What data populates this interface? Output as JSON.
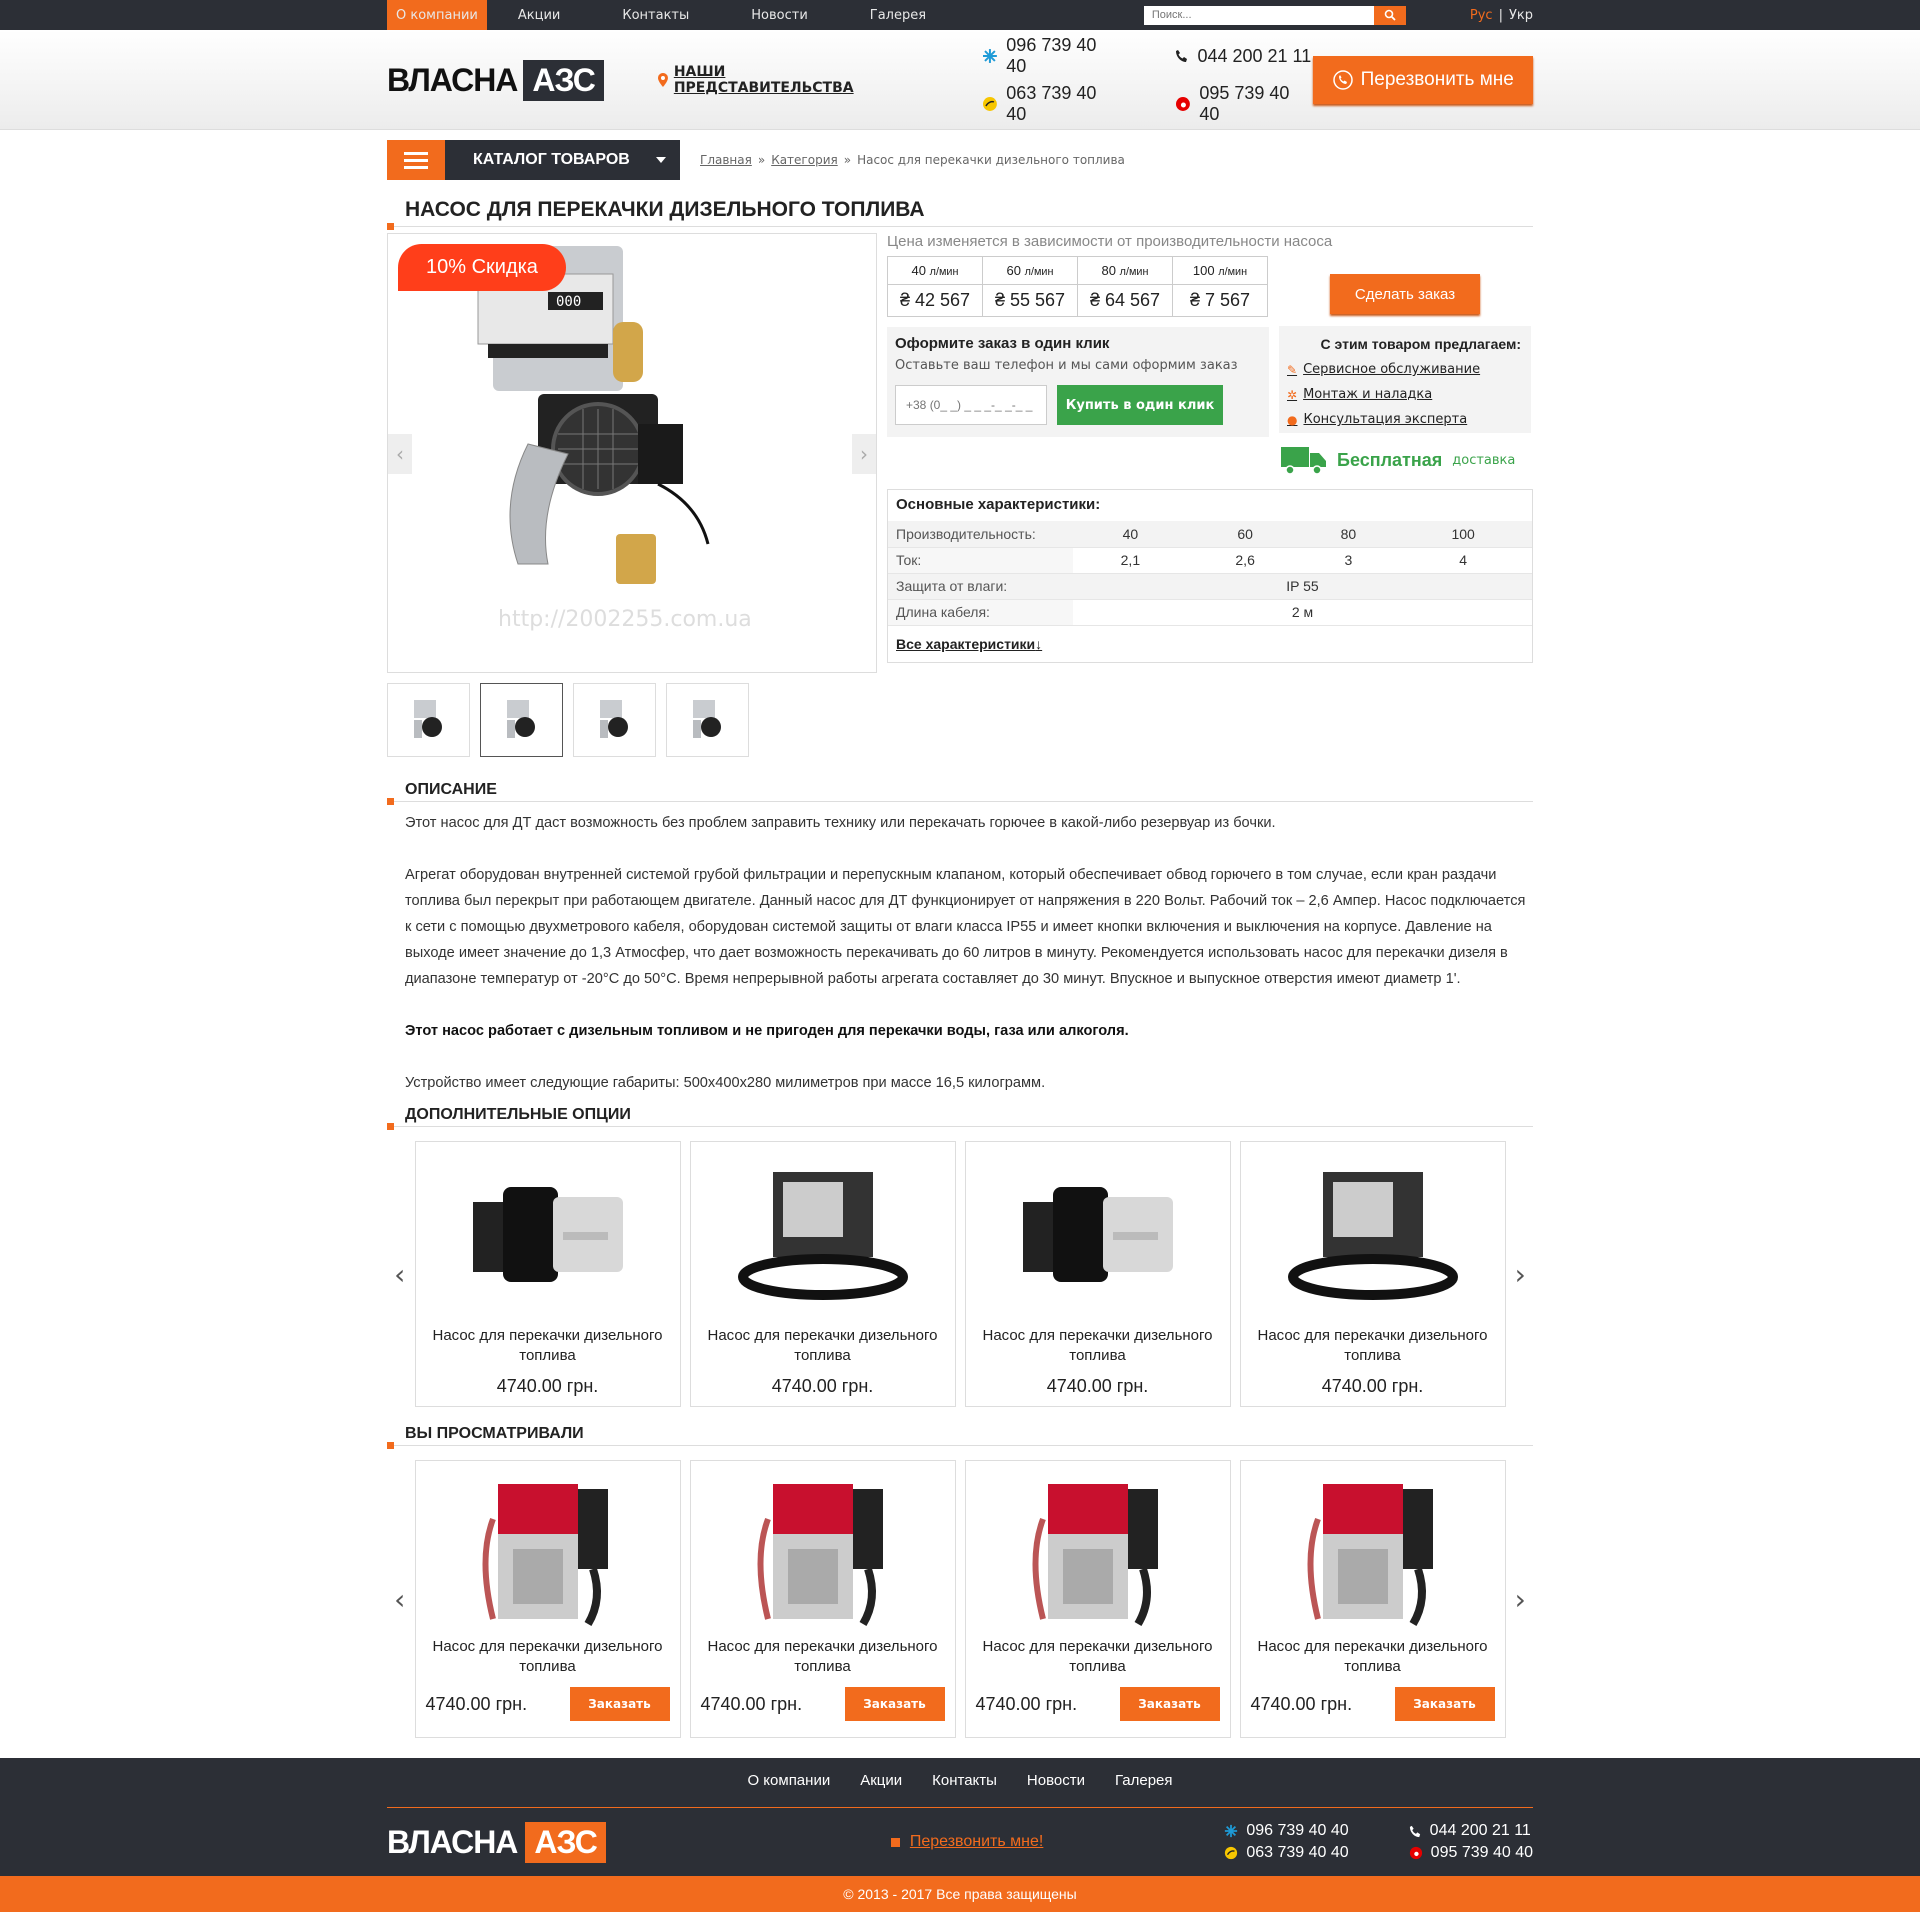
{
  "topbar": {
    "nav": [
      "О компании",
      "Акции",
      "Контакты",
      "Новости",
      "Галерея"
    ],
    "search_placeholder": "Поиск...",
    "lang_ru": "Рус",
    "lang_sep": "|",
    "lang_uk": "Укр"
  },
  "header": {
    "logo_part1": "ВЛАСНА",
    "logo_part2": "АЗС",
    "representatives": "НАШИ ПРЕДСТАВИТЕЛЬСТВА",
    "phone_kyivstar": "096 739 40 40",
    "phone_city": "044 200 21 11",
    "phone_life": "063 739 40 40",
    "phone_vodafone": "095 739 40 40",
    "callback": "Перезвонить мне"
  },
  "catalog": {
    "label": "КАТАЛОГ ТОВАРОВ"
  },
  "breadcrumb": {
    "home": "Главная",
    "category": "Категория",
    "current": "Насос для перекачки дизельного топлива",
    "sep": "»"
  },
  "product": {
    "title": "НАСОС ДЛЯ ПЕРЕКАЧКИ ДИЗЕЛЬНОГО ТОПЛИВА",
    "badge": "10% Скидка",
    "watermark": "http://2002255.com.ua",
    "price_note": "Цена изменяется в зависимости от производительности насоса",
    "price_options": [
      {
        "rate": "40",
        "unit": "л/мин",
        "price": "₴ 42 567"
      },
      {
        "rate": "60",
        "unit": "л/мин",
        "price": "₴ 55 567"
      },
      {
        "rate": "80",
        "unit": "л/мин",
        "price": "₴ 64 567"
      },
      {
        "rate": "100",
        "unit": "л/мин",
        "price": "₴ 7 567"
      }
    ],
    "order_button": "Сделать заказ",
    "one_click_title": "Оформите заказ в один клик",
    "one_click_sub": "Оставьте ваш телефон и мы сами оформим заказ",
    "phone_placeholder": "+38 (0_ _) _ _ _-_ _-_ _",
    "buy_one_click": "Купить в один клик",
    "offers_title": "С этим товаром предлагаем:",
    "offers": [
      "Сервисное обслуживание",
      "Монтаж и наладка",
      "Консультация эксперта"
    ],
    "delivery_bold": "Бесплатная",
    "delivery_normal": "доставка",
    "specs_title": "Основные характеристики:",
    "specs": {
      "perf_label": "Производительность:",
      "perf_values": [
        "40",
        "60",
        "80",
        "100"
      ],
      "current_label": "Ток:",
      "current_values": [
        "2,1",
        "2,6",
        "3",
        "4"
      ],
      "moisture_label": "Защита от влаги:",
      "moisture_value": "IP 55",
      "cable_label": "Длина кабеля:",
      "cable_value": "2 м"
    },
    "all_specs": "Все характеристики"
  },
  "description": {
    "title": "ОПИСАНИЕ",
    "p1": "Этот насос для ДТ даст возможность без проблем заправить технику или перекачать горючее в какой-либо резервуар из бочки.",
    "p2": "Агрегат оборудован внутренней системой грубой фильтрации и перепускным клапаном, который обеспечивает обвод горючего в том случае, если кран раздачи топлива был перекрыт при работающем двигателе. Данный насос для ДТ функционирует от напряжения в 220 Вольт. Рабочий ток – 2,6 Ампер. Насос подключается к сети с помощью двухметрового кабеля, оборудован системой защиты от влаги класса IP55 и имеет кнопки включения и выключения на корпусе. Давление на выходе имеет значение до 1,3 Атмосфер, что дает возможность перекачивать до 60 литров в минуту. Рекомендуется использовать насос для перекачки дизеля в диапазоне температур от -20°С до 50°С. Время непрерывной работы агрегата составляет до 30 минут. Впускное и выпускное отверстия имеют диаметр 1'.",
    "p3": "Этот насос работает с дизельным топливом и не пригоден для перекачки воды, газа или алкоголя.",
    "p4": "Устройство имеет следующие габариты: 500х400х280 милиметров при массе 16,5 килограмм."
  },
  "options": {
    "title": "ДОПОЛНИТЕЛЬНЫЕ ОПЦИИ",
    "items": [
      {
        "name": "Насос для перекачки дизельного топлива",
        "price": "4740.00 грн."
      },
      {
        "name": "Насос для перекачки дизельного топлива",
        "price": "4740.00 грн."
      },
      {
        "name": "Насос для перекачки дизельного топлива",
        "price": "4740.00 грн."
      },
      {
        "name": "Насос для перекачки дизельного топлива",
        "price": "4740.00 грн."
      }
    ]
  },
  "viewed": {
    "title": "ВЫ ПРОСМАТРИВАЛИ",
    "order_label": "Заказать",
    "items": [
      {
        "name": "Насос для перекачки дизельного топлива",
        "price": "4740.00 грн."
      },
      {
        "name": "Насос для перекачки дизельного топлива",
        "price": "4740.00 грн."
      },
      {
        "name": "Насос для перекачки дизельного топлива",
        "price": "4740.00 грн."
      },
      {
        "name": "Насос для перекачки дизельного топлива",
        "price": "4740.00 грн."
      }
    ]
  },
  "footer": {
    "nav": [
      "О компании",
      "Акции",
      "Контакты",
      "Новости",
      "Галерея"
    ],
    "logo_part1": "ВЛАСНА",
    "logo_part2": "АЗС",
    "callback": "Перезвонить мне!",
    "phone_kyivstar": "096 739 40 40",
    "phone_city": "044 200 21 11",
    "phone_life": "063 739 40 40",
    "phone_vodafone": "095 739 40 40",
    "copyright": "© 2013 - 2017 Все права защищены"
  },
  "colors": {
    "accent": "#f26b1d",
    "dark": "#2c2f36",
    "green": "#3aa34a",
    "badge": "#ff3e1a"
  }
}
